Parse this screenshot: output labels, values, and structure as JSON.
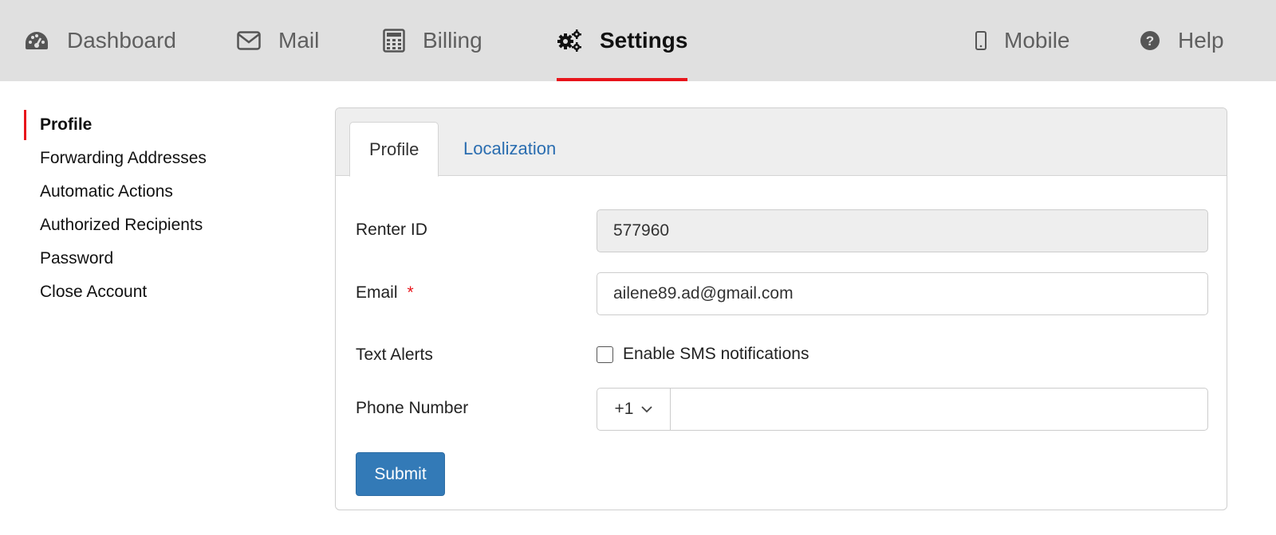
{
  "nav": {
    "items": [
      {
        "label": "Dashboard",
        "icon": "dashboard-gauge-icon"
      },
      {
        "label": "Mail",
        "icon": "envelope-icon"
      },
      {
        "label": "Billing",
        "icon": "calculator-icon"
      },
      {
        "label": "Settings",
        "icon": "gears-icon",
        "active": true
      },
      {
        "label": "Mobile",
        "icon": "mobile-phone-icon"
      },
      {
        "label": "Help",
        "icon": "question-circle-icon"
      }
    ]
  },
  "sidebar": {
    "items": [
      {
        "label": "Profile",
        "active": true
      },
      {
        "label": "Forwarding Addresses"
      },
      {
        "label": "Automatic Actions"
      },
      {
        "label": "Authorized Recipients"
      },
      {
        "label": "Password"
      },
      {
        "label": "Close Account"
      }
    ]
  },
  "panel": {
    "tabs": [
      {
        "label": "Profile",
        "active": true
      },
      {
        "label": "Localization"
      }
    ],
    "form": {
      "renter_id_label": "Renter ID",
      "renter_id_value": "577960",
      "email_label": "Email",
      "email_required_mark": "*",
      "email_value": "ailene89.ad@gmail.com",
      "text_alerts_label": "Text Alerts",
      "sms_checkbox_label": "Enable SMS notifications",
      "sms_checked": false,
      "phone_label": "Phone Number",
      "country_code": "+1",
      "phone_value": "",
      "submit_label": "Submit"
    }
  },
  "colors": {
    "accent_red": "#e8141b",
    "nav_bg": "#e0e0e0",
    "link_blue": "#2a6db0",
    "button_blue": "#337ab7"
  }
}
